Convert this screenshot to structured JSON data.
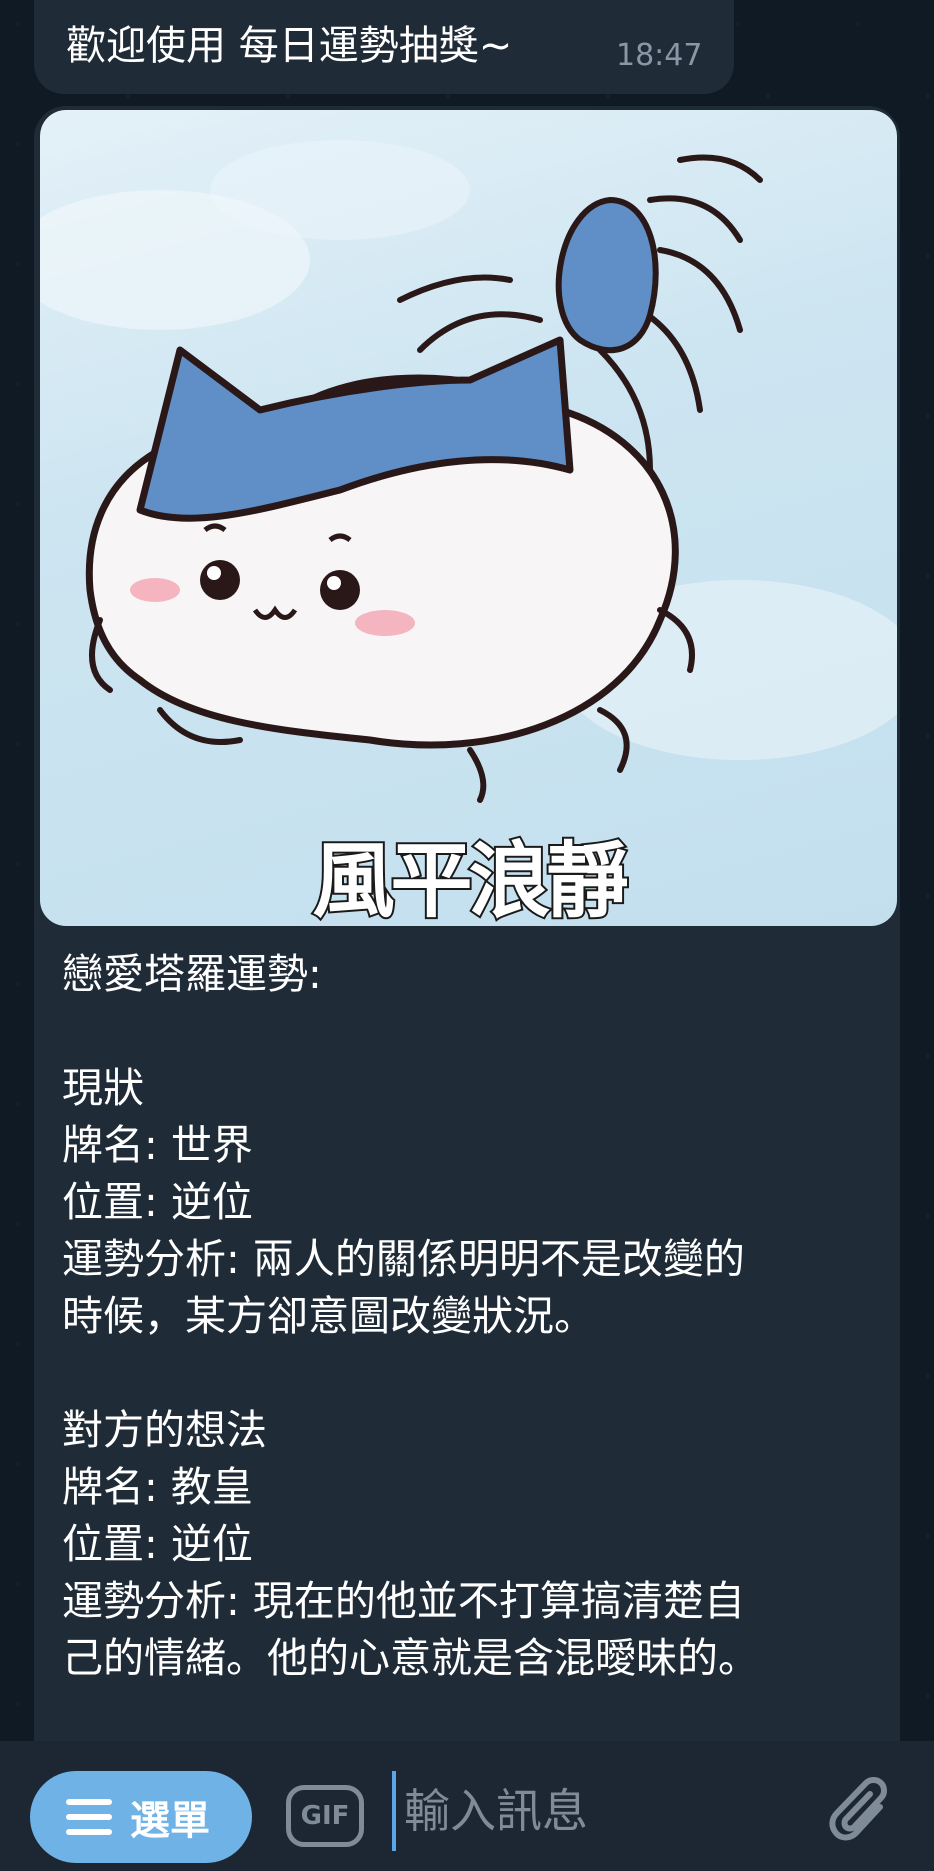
{
  "greeting": {
    "text": "歡迎使用 每日運勢抽獎~",
    "time": "18:47"
  },
  "card": {
    "image_caption": "風平浪靜",
    "lines": [
      "戀愛塔羅運勢:",
      "",
      "現狀",
      "牌名: 世界",
      "位置: 逆位",
      "運勢分析: 兩人的關係明明不是改變的",
      "時候，某方卻意圖改變狀況。",
      "",
      "對方的想法",
      "牌名: 教皇",
      "位置: 逆位",
      "運勢分析: 現在的他並不打算搞清楚自",
      "己的情緒。他的心意就是含混曖昧的。"
    ]
  },
  "input_bar": {
    "menu_label": "選單",
    "gif_label": "GIF",
    "input_placeholder": "輸入訊息",
    "attach_icon": "paperclip-icon"
  },
  "colors": {
    "background": "#0f1a24",
    "bubble": "#1f2b37",
    "menu_button": "#6eb2e6",
    "input_bar": "#1d2733"
  }
}
